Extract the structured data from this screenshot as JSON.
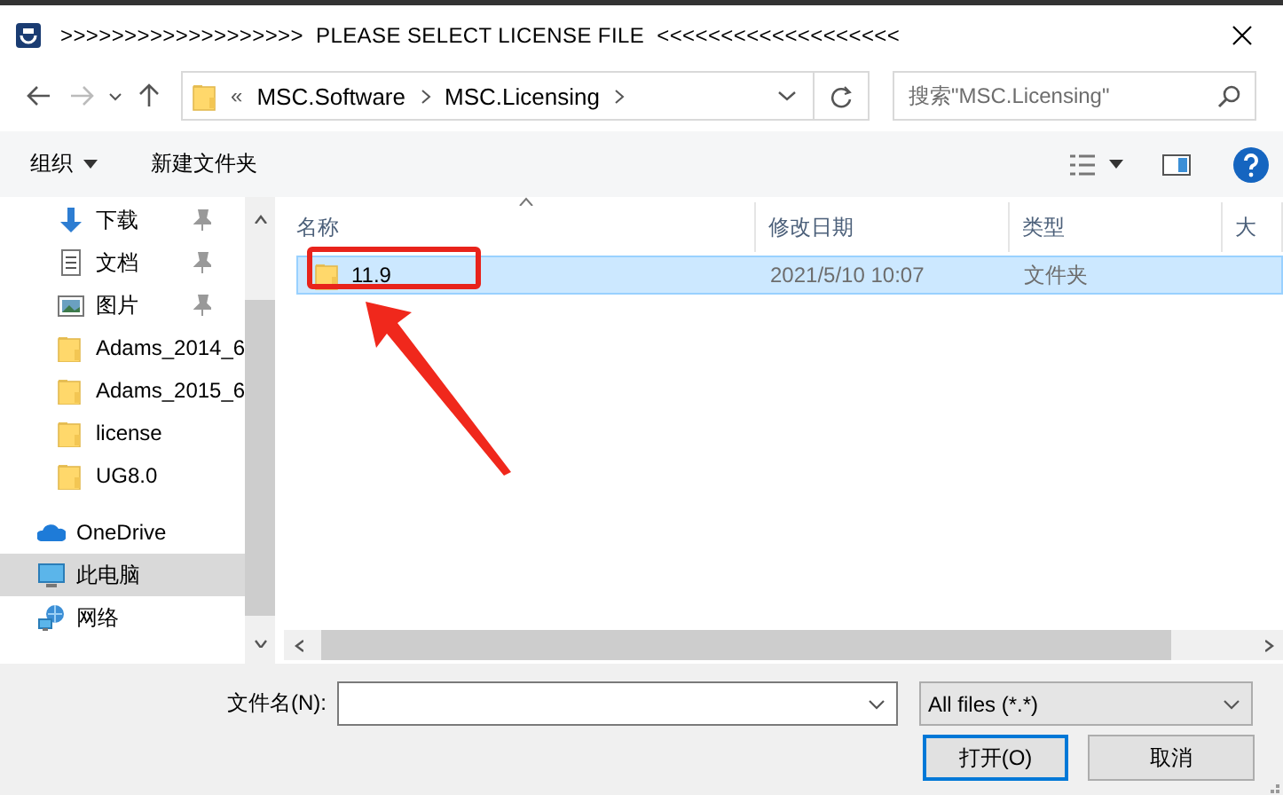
{
  "window": {
    "title": ">>>>>>>>>>>>>>>>>>>  PLEASE SELECT LICENSE FILE  <<<<<<<<<<<<<<<<<<<"
  },
  "address": {
    "overflow": "«",
    "crumbs": [
      "MSC.Software",
      "MSC.Licensing"
    ]
  },
  "search": {
    "placeholder": "搜索\"MSC.Licensing\""
  },
  "toolbar": {
    "organize": "组织",
    "new_folder": "新建文件夹"
  },
  "sidebar": {
    "items": [
      {
        "kind": "group",
        "children": [
          {
            "kind": "download",
            "label": "下载",
            "pinned": true,
            "selected": false
          },
          {
            "kind": "document",
            "label": "文档",
            "pinned": true,
            "selected": false
          },
          {
            "kind": "pictures",
            "label": "图片",
            "pinned": true,
            "selected": false
          },
          {
            "kind": "folder",
            "label": "Adams_2014_6",
            "pinned": false,
            "selected": false
          },
          {
            "kind": "folder",
            "label": "Adams_2015_6",
            "pinned": false,
            "selected": false
          },
          {
            "kind": "folder",
            "label": "license",
            "pinned": false,
            "selected": false
          },
          {
            "kind": "folder",
            "label": "UG8.0",
            "pinned": false,
            "selected": false
          }
        ]
      },
      {
        "kind": "onedrive",
        "label": "OneDrive",
        "selected": false
      },
      {
        "kind": "pc",
        "label": "此电脑",
        "selected": true
      },
      {
        "kind": "network",
        "label": "网络",
        "selected": false
      }
    ]
  },
  "table": {
    "columns": [
      "名称",
      "修改日期",
      "类型",
      "大"
    ],
    "rows": [
      {
        "name": "11.9",
        "date": "2021/5/10 10:07",
        "type": "文件夹",
        "selected": true
      }
    ]
  },
  "footer": {
    "filename_label": "文件名(N):",
    "filetype": "All files (*.*)",
    "buttons": [
      {
        "label": "打开(O)",
        "default": true
      },
      {
        "label": "取消",
        "default": false
      }
    ]
  }
}
